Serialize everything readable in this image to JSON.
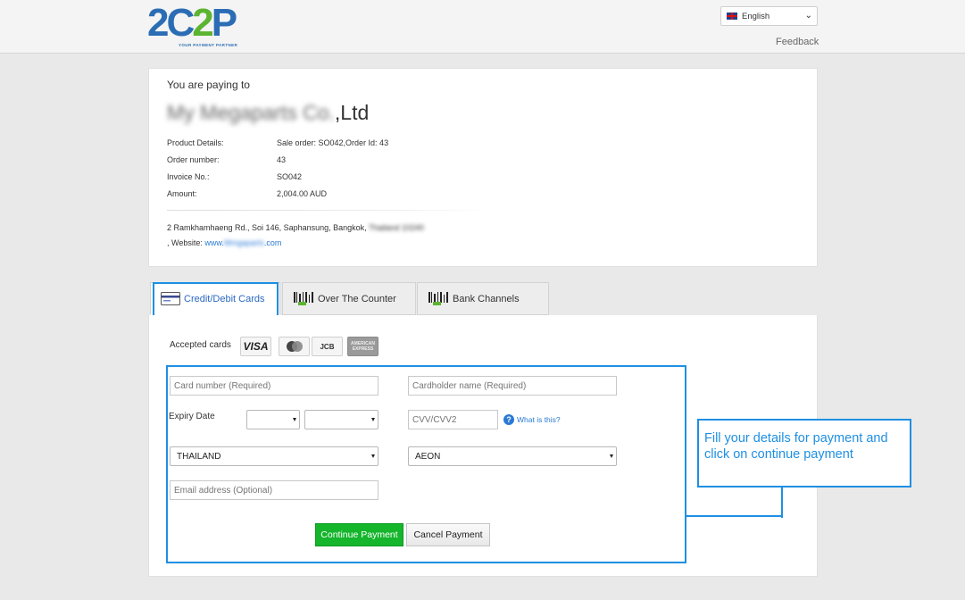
{
  "header": {
    "logo_text_a": "2C",
    "logo_text_b": "2",
    "logo_text_c": "P",
    "logo_tagline": "YOUR PAYMENT PARTNER",
    "language": "English",
    "feedback": "Feedback"
  },
  "summary": {
    "paying_to_label": "You are paying to",
    "merchant_blurred": "My Megaparts Co.",
    "merchant_suffix": ",Ltd",
    "rows": [
      {
        "label": "Product Details:",
        "value": "Sale order: SO042,Order Id: 43"
      },
      {
        "label": "Order number:",
        "value": "43"
      },
      {
        "label": "Invoice No.:",
        "value": "SO042"
      },
      {
        "label": "Amount:",
        "value": "2,004.00 AUD"
      }
    ],
    "address_visible": "2 Ramkhamhaeng Rd., Soi 146, Saphansung, Bangkok, ",
    "address_blurred": "Thailand 10240",
    "website_prefix": ", Website: ",
    "website_visible": "www.",
    "website_blurred": "Mmgaparts",
    "website_suffix": ".com"
  },
  "tabs": {
    "cards": "Credit/Debit Cards",
    "otc": "Over The Counter",
    "bank": "Bank Channels"
  },
  "form": {
    "accepted_cards_label": "Accepted cards",
    "card_logos": {
      "visa": "VISA",
      "jcb": "JCB",
      "amex": "AMERICAN EXPRESS"
    },
    "card_number_placeholder": "Card number (Required)",
    "cardholder_placeholder": "Cardholder name (Required)",
    "expiry_label": "Expiry Date",
    "expiry_month": "",
    "expiry_year": "",
    "cvv_placeholder": "CVV/CVV2",
    "help_icon_glyph": "?",
    "what_is_this": "What is this?",
    "country": "THAILAND",
    "issuer": "AEON",
    "email_placeholder": "Email address (Optional)",
    "continue_label": "Continue Payment",
    "cancel_label": "Cancel Payment"
  },
  "callout": {
    "text": "Fill your details for payment and click on continue payment"
  },
  "colors": {
    "accent_blue": "#1e8fe3",
    "continue_green": "#15b52c",
    "link_blue": "#2a7ad5"
  }
}
